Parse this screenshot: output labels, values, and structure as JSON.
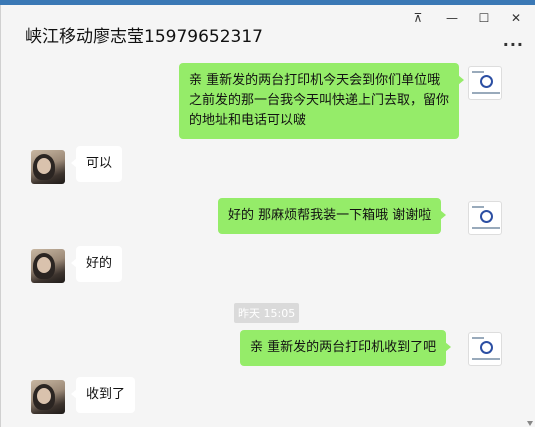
{
  "window": {
    "title": "峡江移动廖志莹15979652317",
    "controls": {
      "pin": "⊼",
      "minimize": "—",
      "maximize": "☐",
      "close": "✕"
    },
    "more": "···"
  },
  "messages": [
    {
      "side": "right",
      "text": "亲  重新发的两台打印机今天会到你们单位哦  之前发的那一台我今天叫快递上门去取，留你的地址和电话可以啵"
    },
    {
      "side": "left",
      "text": "可以"
    },
    {
      "side": "right",
      "text": "好的  那麻烦帮我装一下箱哦 谢谢啦"
    },
    {
      "side": "left",
      "text": "好的"
    },
    {
      "side": "right",
      "text": "亲 重新发的两台打印机收到了吧"
    },
    {
      "side": "left",
      "text": "收到了"
    }
  ],
  "timestamp": "昨天 15:05",
  "colors": {
    "bubble_right": "#95ec69",
    "bubble_left": "#ffffff",
    "background": "#f5f5f5"
  }
}
